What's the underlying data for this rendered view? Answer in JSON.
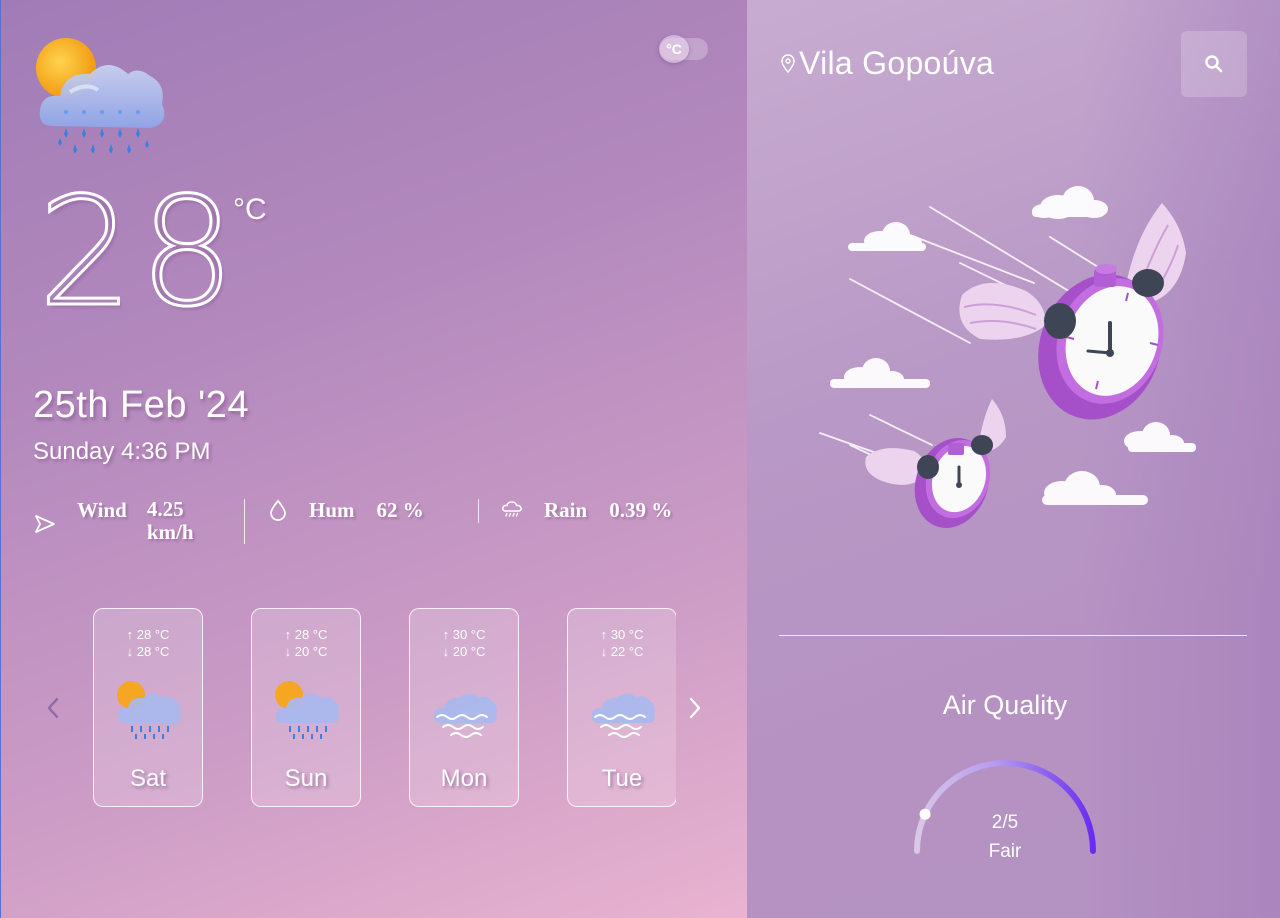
{
  "current": {
    "icon": "sun-cloud-rain-icon",
    "temperature": "28",
    "unit": "°C",
    "date": "25th Feb '24",
    "day_time": "Sunday 4:36 PM"
  },
  "unit_toggle": {
    "label": "°C",
    "state": "celsius"
  },
  "stats": {
    "wind": {
      "label": "Wind",
      "value": "4.25 km/h",
      "icon": "navigation-arrow-icon"
    },
    "humidity": {
      "label": "Hum",
      "value": "62 %",
      "icon": "droplet-icon"
    },
    "rain": {
      "label": "Rain",
      "value": "0.39 %",
      "icon": "cloud-rain-icon"
    }
  },
  "forecast": [
    {
      "day": "Sat",
      "high": "↑ 28 °C",
      "low": "↓ 28 °C",
      "icon": "sun-cloud-rain-icon"
    },
    {
      "day": "Sun",
      "high": "↑ 28 °C",
      "low": "↓ 20 °C",
      "icon": "sun-cloud-rain-icon"
    },
    {
      "day": "Mon",
      "high": "↑ 30 °C",
      "low": "↓ 20 °C",
      "icon": "cloud-fog-icon"
    },
    {
      "day": "Tue",
      "high": "↑ 30 °C",
      "low": "↓ 22 °C",
      "icon": "cloud-fog-icon"
    }
  ],
  "location": {
    "name": "Vila Gopoúva",
    "icon": "map-pin-icon"
  },
  "search": {
    "icon": "search-icon"
  },
  "air_quality": {
    "title": "Air Quality",
    "index": "2/5",
    "label": "Fair",
    "level": 2,
    "max": 5
  },
  "colors": {
    "gauge_start": "#d9c8e6",
    "gauge_end": "#6a2cf0",
    "rain_drop": "#3d7fe0",
    "sun": "#f4a51c",
    "clock_purple": "#b45fd0"
  }
}
